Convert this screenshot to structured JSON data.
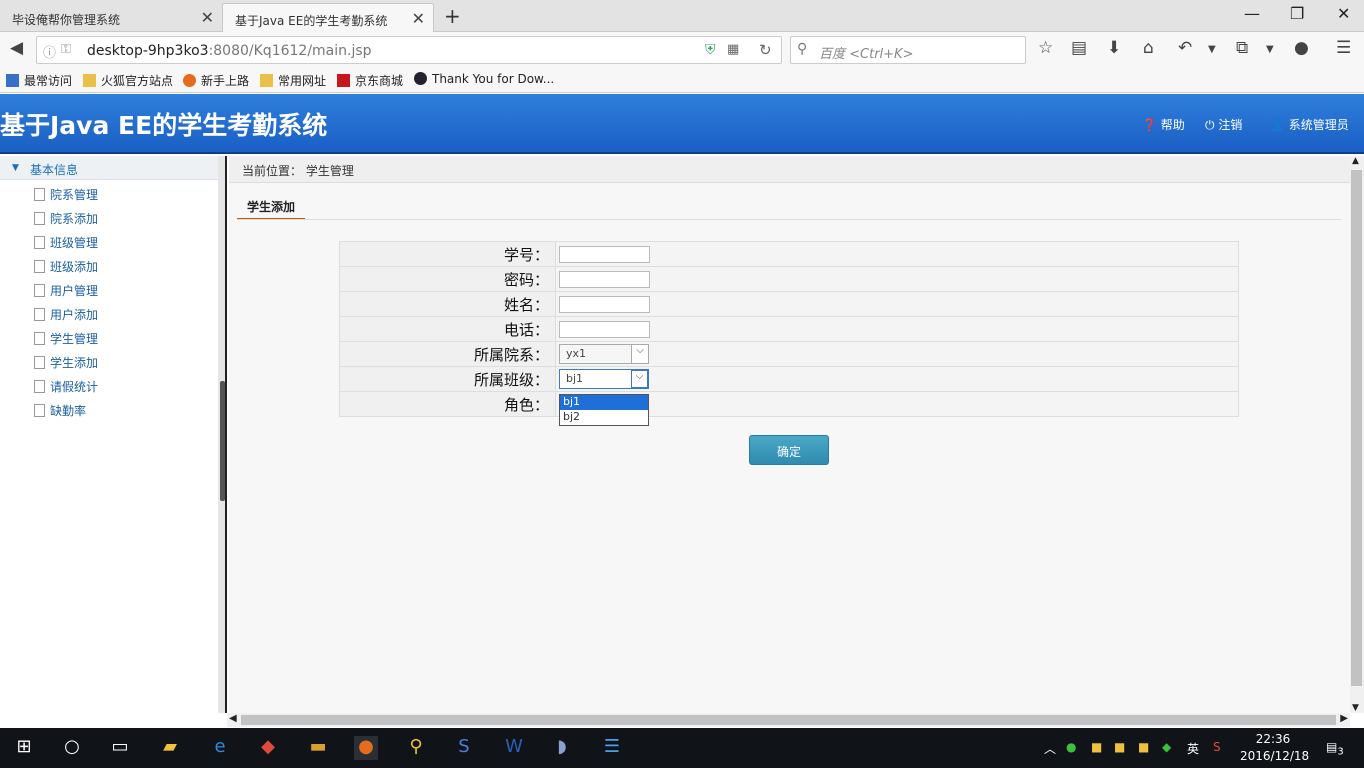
{
  "browser": {
    "tabs": [
      {
        "label": "毕设俺帮你管理系统"
      },
      {
        "label": "基于Java EE的学生考勤系统"
      }
    ],
    "url_host": "desktop-9hp3ko3",
    "url_rest": ":8080/Kq1612/main.jsp",
    "search_placeholder": "百度 <Ctrl+K>",
    "bookmarks": [
      {
        "label": "最常访问"
      },
      {
        "label": "火狐官方站点"
      },
      {
        "label": "新手上路"
      },
      {
        "label": "常用网址"
      },
      {
        "label": "京东商城"
      },
      {
        "label": "Thank You for Dow..."
      }
    ]
  },
  "header": {
    "title": "基于Java EE的学生考勤系统",
    "help": "帮助",
    "logout": "注销",
    "user": "系统管理员"
  },
  "sidebar": {
    "section": "基本信息",
    "items": [
      {
        "label": "院系管理"
      },
      {
        "label": "院系添加"
      },
      {
        "label": "班级管理"
      },
      {
        "label": "班级添加"
      },
      {
        "label": "用户管理"
      },
      {
        "label": "用户添加"
      },
      {
        "label": "学生管理"
      },
      {
        "label": "学生添加"
      },
      {
        "label": "请假统计"
      },
      {
        "label": "缺勤率"
      }
    ]
  },
  "main": {
    "breadcrumb": "当前位置： 学生管理",
    "tab": "学生添加",
    "form": {
      "student_id_label": "学号：",
      "password_label": "密码：",
      "name_label": "姓名：",
      "phone_label": "电话：",
      "dept_label": "所属院系：",
      "dept_value": "yx1",
      "class_label": "所属班级：",
      "class_value": "bj1",
      "class_options": [
        "bj1",
        "bj2"
      ],
      "role_label": "角色："
    },
    "submit": "确定"
  },
  "taskbar": {
    "time": "22:36",
    "date": "2016/12/18",
    "ime": "英",
    "notifications": "3"
  }
}
